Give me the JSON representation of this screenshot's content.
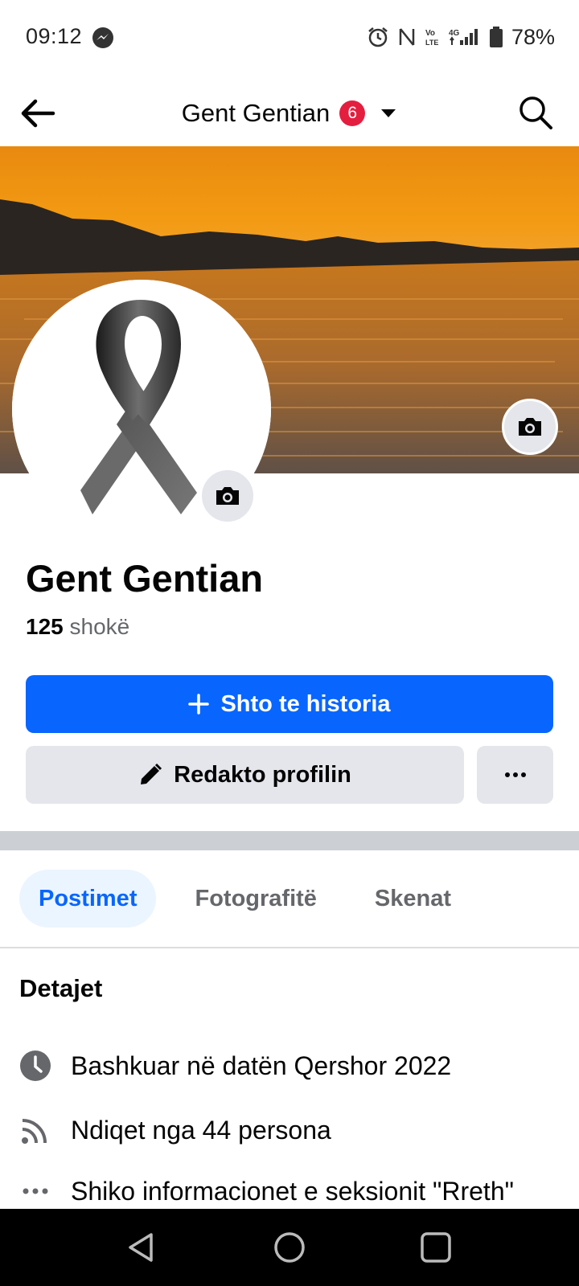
{
  "status_bar": {
    "time": "09:12",
    "icons": [
      "messenger-icon",
      "alarm-icon",
      "nfc-icon",
      "volte-icon",
      "4g-signal-icon",
      "battery-icon"
    ],
    "network_label": "Vo LTE",
    "battery": "78%"
  },
  "header": {
    "title": "Gent Gentian",
    "badge_count": "6"
  },
  "profile": {
    "name": "Gent Gentian",
    "friends_count": "125",
    "friends_label": "shokë"
  },
  "actions": {
    "add_story": "Shto te historia",
    "edit_profile": "Redakto profilin"
  },
  "tabs": [
    {
      "label": "Postimet",
      "active": true
    },
    {
      "label": "Fotografitë",
      "active": false
    },
    {
      "label": "Skenat",
      "active": false
    }
  ],
  "details": {
    "heading": "Detajet",
    "items": [
      {
        "icon": "clock-icon",
        "text": "Bashkuar në datën Qershor 2022"
      },
      {
        "icon": "rss-icon",
        "text": "Ndiqet nga 44 persona"
      },
      {
        "icon": "more-dots-icon",
        "text": "Shiko informacionet e seksionit \"Rreth\""
      }
    ]
  },
  "colors": {
    "primary": "#0866ff",
    "badge": "#e41e3f",
    "secondary_button": "#e4e6eb",
    "muted_text": "#65676b"
  }
}
